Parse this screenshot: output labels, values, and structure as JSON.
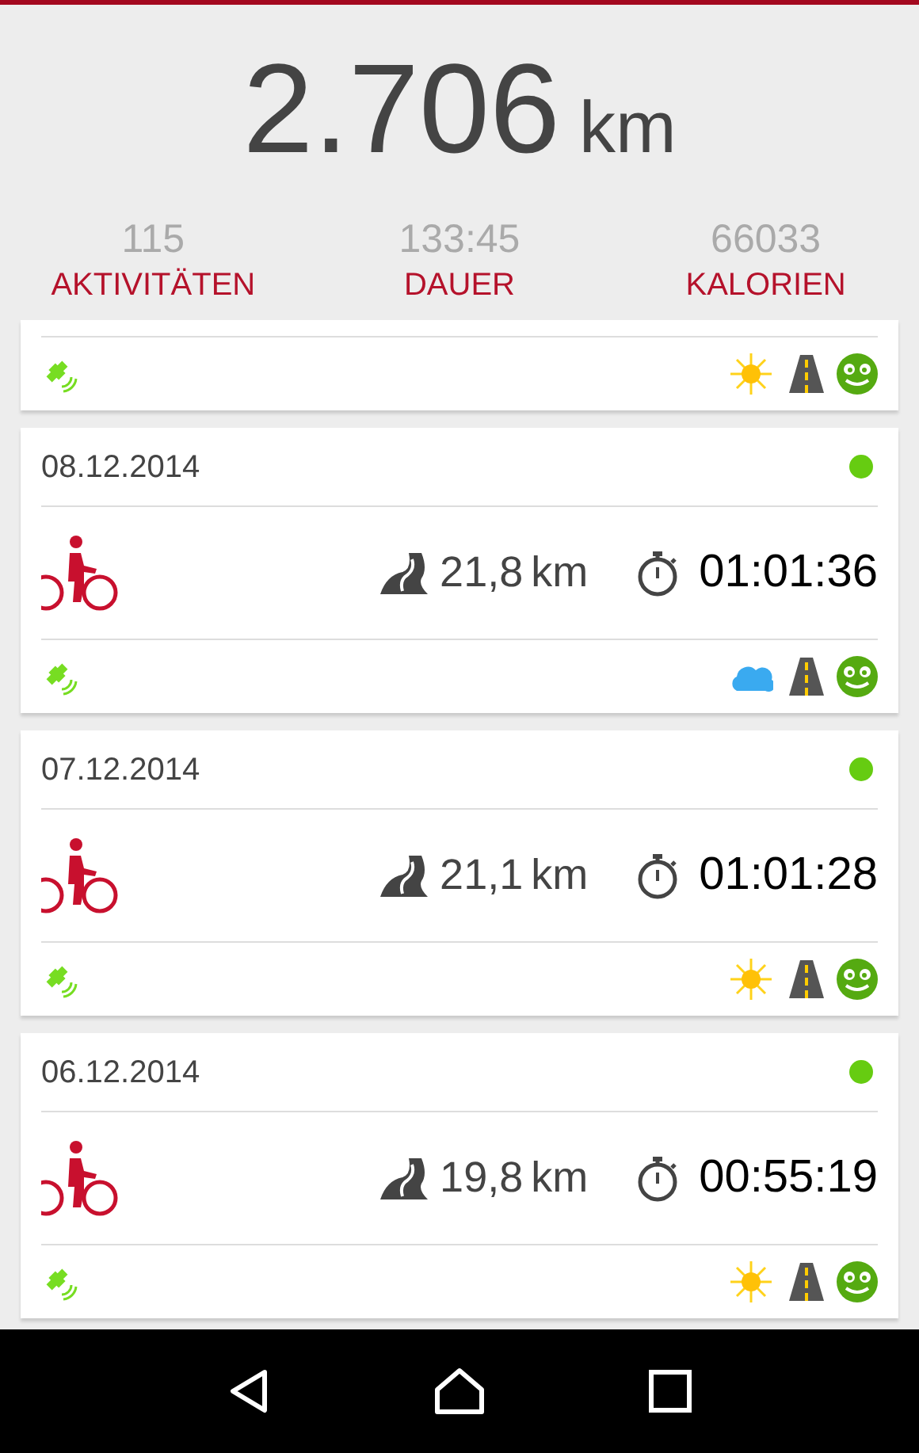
{
  "summary": {
    "distance": "2.706",
    "unit": "km",
    "stats": [
      {
        "value": "115",
        "label": "AKTIVITÄTEN"
      },
      {
        "value": "133:45",
        "label": "DAUER"
      },
      {
        "value": "66033",
        "label": "KALORIEN"
      }
    ]
  },
  "activities": [
    {
      "kind": "partial",
      "weather": {
        "kind": "sun"
      }
    },
    {
      "kind": "full",
      "date": "08.12.2014",
      "color": "#66cc11",
      "distance": "21,8",
      "unit": "km",
      "duration": "01:01:36",
      "weather": {
        "kind": "cloud"
      }
    },
    {
      "kind": "full",
      "date": "07.12.2014",
      "color": "#66cc11",
      "distance": "21,1",
      "unit": "km",
      "duration": "01:01:28",
      "weather": {
        "kind": "sun"
      }
    },
    {
      "kind": "full",
      "date": "06.12.2014",
      "color": "#66cc11",
      "distance": "19,8",
      "unit": "km",
      "duration": "00:55:19",
      "weather": {
        "kind": "sun"
      }
    }
  ]
}
